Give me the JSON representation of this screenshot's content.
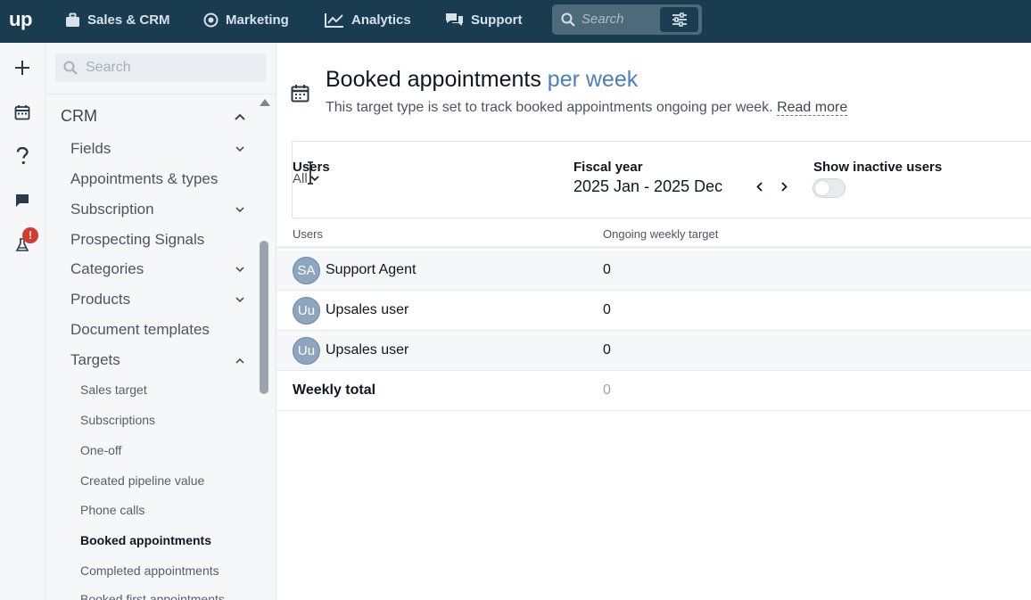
{
  "topbar": {
    "logo": "up",
    "nav": [
      {
        "label": "Sales & CRM",
        "icon": "briefcase-icon"
      },
      {
        "label": "Marketing",
        "icon": "target-icon"
      },
      {
        "label": "Analytics",
        "icon": "chart-line-icon"
      },
      {
        "label": "Support",
        "icon": "chat-bubbles-icon"
      }
    ],
    "search_placeholder": "Search"
  },
  "rail": {
    "badge": "!"
  },
  "sidebar": {
    "search_placeholder": "Search",
    "section": "CRM",
    "items": [
      {
        "label": "Fields",
        "chevron": "down"
      },
      {
        "label": "Appointments & types",
        "chevron": ""
      },
      {
        "label": "Subscription",
        "chevron": "down"
      },
      {
        "label": "Prospecting Signals",
        "chevron": ""
      },
      {
        "label": "Categories",
        "chevron": "down"
      },
      {
        "label": "Products",
        "chevron": "down"
      },
      {
        "label": "Document templates",
        "chevron": ""
      },
      {
        "label": "Targets",
        "chevron": "up"
      }
    ],
    "sub_items": [
      {
        "label": "Sales target"
      },
      {
        "label": "Subscriptions"
      },
      {
        "label": "One-off"
      },
      {
        "label": "Created pipeline value"
      },
      {
        "label": "Phone calls"
      },
      {
        "label": "Booked appointments"
      },
      {
        "label": "Completed appointments"
      },
      {
        "label": "Booked first appointments"
      }
    ]
  },
  "main": {
    "title": "Booked appointments",
    "title_accent": "per week",
    "subtitle": "This target type is set to track booked appointments ongoing per week.",
    "read_more": "Read more",
    "filters": {
      "users_label": "Users",
      "users_value": "All",
      "fiscal_label": "Fiscal year",
      "fiscal_value": "2025 Jan - 2025 Dec",
      "inactive_label": "Show inactive users",
      "inactive_on": false
    },
    "table": {
      "col_users": "Users",
      "col_target": "Ongoing weekly target",
      "rows": [
        {
          "initials": "SA",
          "name": "Support Agent",
          "value": "0"
        },
        {
          "initials": "Uu",
          "name": "Upsales user",
          "value": "0"
        },
        {
          "initials": "Uu",
          "name": "Upsales user",
          "value": "0"
        }
      ],
      "total_label": "Weekly total",
      "total_value": "0"
    }
  }
}
